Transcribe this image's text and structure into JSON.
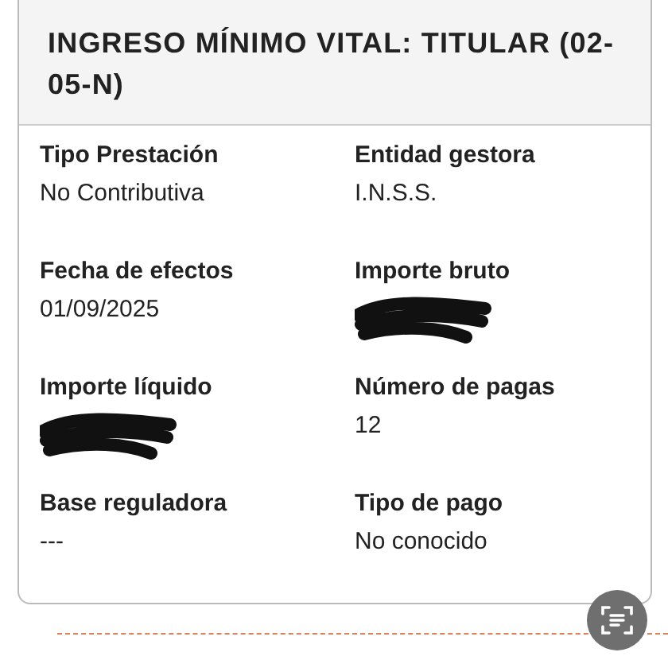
{
  "card": {
    "title": "INGRESO MÍNIMO VITAL: TITULAR (02-05-N)",
    "fields": [
      {
        "label": "Tipo Prestación",
        "value": "No Contributiva",
        "kind": "text"
      },
      {
        "label": "Entidad gestora",
        "value": "I.N.S.S.",
        "kind": "text"
      },
      {
        "label": "Fecha de efectos",
        "value": "01/09/2025",
        "kind": "text"
      },
      {
        "label": "Importe bruto",
        "kind": "redacted"
      },
      {
        "label": "Importe líquido",
        "kind": "redacted"
      },
      {
        "label": "Número de pagas",
        "value": "12",
        "kind": "text"
      },
      {
        "label": "Base reguladora",
        "value": "---",
        "kind": "text"
      },
      {
        "label": "Tipo de pago",
        "value": "No conocido",
        "kind": "text"
      }
    ]
  }
}
